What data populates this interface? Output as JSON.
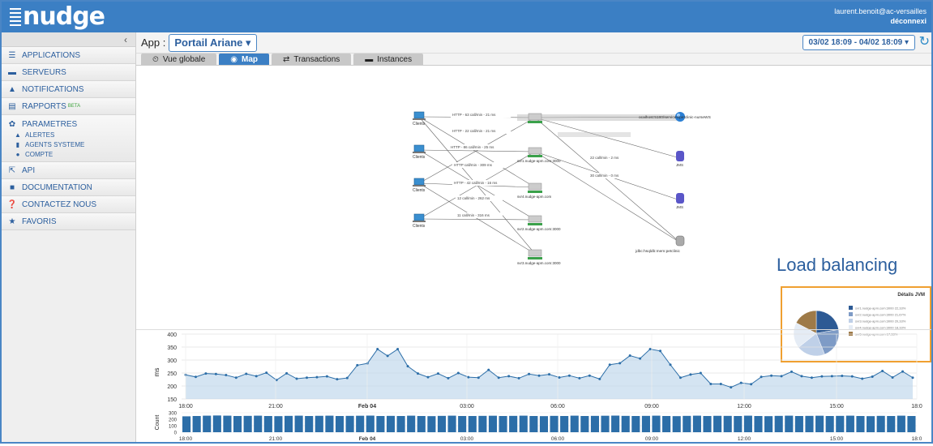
{
  "header": {
    "logo_text": "nudge",
    "user_email": "laurent.benoit@ac-versailles",
    "logout_label": "déconnexi"
  },
  "sidebar": {
    "collapse_label": "‹",
    "items": [
      {
        "label": "APPLICATIONS",
        "icon": "list-icon"
      },
      {
        "label": "SERVEURS",
        "icon": "server-icon"
      },
      {
        "label": "NOTIFICATIONS",
        "icon": "warning-icon"
      },
      {
        "label": "RAPPORTS",
        "icon": "report-icon",
        "badge": "BETA"
      }
    ],
    "parametres": {
      "label": "PARAMETRES",
      "sub": [
        {
          "label": "ALERTES",
          "icon": "warning-icon"
        },
        {
          "label": "AGENTS SYSTEME",
          "icon": "bar-chart-icon"
        },
        {
          "label": "COMPTE",
          "icon": "user-icon"
        }
      ]
    },
    "items2": [
      {
        "label": "API",
        "icon": "share-icon"
      },
      {
        "label": "DOCUMENTATION",
        "icon": "book-icon"
      },
      {
        "label": "CONTACTEZ NOUS",
        "icon": "question-icon"
      },
      {
        "label": "FAVORIS",
        "icon": "star-icon"
      }
    ]
  },
  "appbar": {
    "app_label": "App :",
    "app_value": "Portail Ariane ▾",
    "date_range": "03/02 18:09 - 04/02 18:09 ▾"
  },
  "tabs": [
    {
      "label": "Vue globale",
      "icon": "clock-icon",
      "active": false
    },
    {
      "label": "Map",
      "icon": "globe-icon",
      "active": true
    },
    {
      "label": "Transactions",
      "icon": "exchange-icon",
      "active": false
    },
    {
      "label": "Instances",
      "icon": "server-icon",
      "active": false
    }
  ],
  "map": {
    "clients": [
      "Clients",
      "Clients",
      "Clients",
      "Clients"
    ],
    "servers": [
      "svr1.nudge-apm.com:3000",
      "svr4.nudge-apm.com",
      "svr2.nudge-apm.com:3000",
      "svr3.nudge-apm.com:3000"
    ],
    "targets": {
      "ws": "ocalhost:5180/services/petclinic-nurseWS",
      "jms1": "JMS",
      "jms2": "JMS",
      "db": "jdbc:hsqldb:mem:petclinic"
    },
    "edge_labels": [
      "HTTP - 63 call/min - 21 ms",
      "HTTP - 22 call/min - 21 ms",
      "HTTP - 86 call/min - 25 ms",
      "HTTP call/min - 309 ms",
      "HTTP - 42 call/min - 16 ms",
      "12 call/min - 262 ms",
      "11 call/min - 316 ms",
      "22 call/min - 2 ms",
      "30 call/min - 0 ms"
    ]
  },
  "load_balancing": {
    "title": "Load balancing",
    "panel_title": "Détails JVM",
    "legend": [
      "svr1.nudge-apm.com:3000  22,33%",
      "svr2.nudge-apm.com:3000  21,67%",
      "svr3.nudge-apm.com:3000  20,33%",
      "svr4.nudge-apm.com:3000  18,33%",
      "svr5.nudge-apm.com  17,33%"
    ],
    "slices": [
      22.33,
      21.67,
      20.33,
      18.33,
      17.33
    ],
    "colors": [
      "#2d5a94",
      "#7e9bc6",
      "#bfd0e8",
      "#e5ecf5",
      "#9e7a48"
    ]
  },
  "chart_data": [
    {
      "type": "area",
      "ylabel": "ms",
      "ylim": [
        150,
        400
      ],
      "yticks": [
        150,
        200,
        250,
        300,
        350,
        400
      ],
      "xticks": [
        "18:00",
        "21:00",
        "Feb 04",
        "03:00",
        "06:00",
        "09:00",
        "12:00",
        "15:00",
        "18:0"
      ],
      "values": [
        243,
        235,
        248,
        246,
        242,
        232,
        247,
        238,
        251,
        223,
        249,
        228,
        232,
        234,
        237,
        226,
        231,
        280,
        287,
        342,
        316,
        342,
        276,
        248,
        234,
        248,
        230,
        250,
        234,
        232,
        262,
        232,
        238,
        230,
        246,
        240,
        245,
        233,
        240,
        230,
        240,
        227,
        282,
        288,
        317,
        306,
        342,
        335,
        282,
        232,
        244,
        250,
        208,
        208,
        195,
        212,
        207,
        235,
        240,
        238,
        255,
        238,
        232,
        237,
        238,
        239,
        237,
        228,
        236,
        258,
        233,
        256,
        232
      ]
    },
    {
      "type": "bar",
      "ylabel": "Count",
      "ylim": [
        0,
        300
      ],
      "yticks": [
        0,
        100,
        200,
        300
      ],
      "xticks": [
        "18:00",
        "21:00",
        "Feb 04",
        "03:00",
        "06:00",
        "09:00",
        "12:00",
        "15:00",
        "18:0"
      ],
      "values": [
        245,
        250,
        255,
        258,
        255,
        250,
        252,
        255,
        250,
        248,
        252,
        255,
        250,
        253,
        255,
        250,
        252,
        254,
        256,
        250,
        252,
        250,
        255,
        250,
        248,
        252,
        255,
        250,
        250,
        252,
        254,
        250,
        252,
        255,
        250,
        248,
        252,
        250,
        255,
        250,
        252,
        254,
        256,
        252,
        250,
        252,
        255,
        250,
        248,
        252,
        255,
        250,
        253,
        252,
        250,
        255,
        250,
        248,
        252,
        255,
        250,
        252,
        254,
        250,
        252,
        255,
        250,
        248,
        252,
        250,
        255,
        250
      ]
    }
  ]
}
